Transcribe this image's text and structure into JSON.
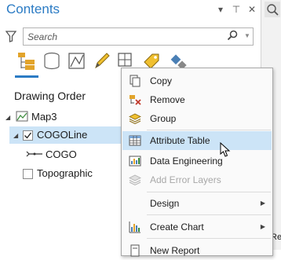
{
  "pane": {
    "title": "Contents",
    "title_buttons": [
      "▾",
      "⊤",
      "✕"
    ],
    "search_placeholder": "Search",
    "heading": "Drawing Order"
  },
  "tree": {
    "map": "Map3",
    "layer_selected": "COGOLine",
    "sublayer": "COGO",
    "layer2": "Topographic"
  },
  "menu": {
    "items": [
      {
        "label": "Copy",
        "icon": "copy-icon"
      },
      {
        "label": "Remove",
        "icon": "remove-icon"
      },
      {
        "label": "Group",
        "icon": "group-icon"
      },
      {
        "label": "Attribute Table",
        "icon": "table-icon"
      },
      {
        "label": "Data Engineering",
        "icon": "data-engineering-icon"
      },
      {
        "label": "Add Error Layers",
        "icon": "error-layers-icon"
      },
      {
        "label": "Design",
        "icon": ""
      },
      {
        "label": "Create Chart",
        "icon": "chart-icon"
      },
      {
        "label": "New Report",
        "icon": "report-icon"
      }
    ]
  },
  "right_side": {
    "label": "Repo"
  },
  "colors": {
    "accent": "#2b7bc4",
    "selection": "#cce4f7"
  }
}
